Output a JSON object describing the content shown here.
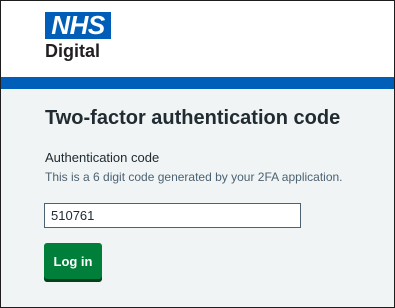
{
  "header": {
    "logo_text": "NHS",
    "logo_subtext": "Digital"
  },
  "main": {
    "title": "Two-factor authentication code",
    "field_label": "Authentication code",
    "field_hint": "This is a 6 digit code generated by your 2FA application.",
    "code_value": "510761",
    "login_label": "Log in"
  },
  "colors": {
    "nhs_blue": "#005eb8",
    "button_green": "#007f3b",
    "page_background": "#f0f4f5",
    "text_dark": "#212b32",
    "hint_text": "#4c6272"
  }
}
